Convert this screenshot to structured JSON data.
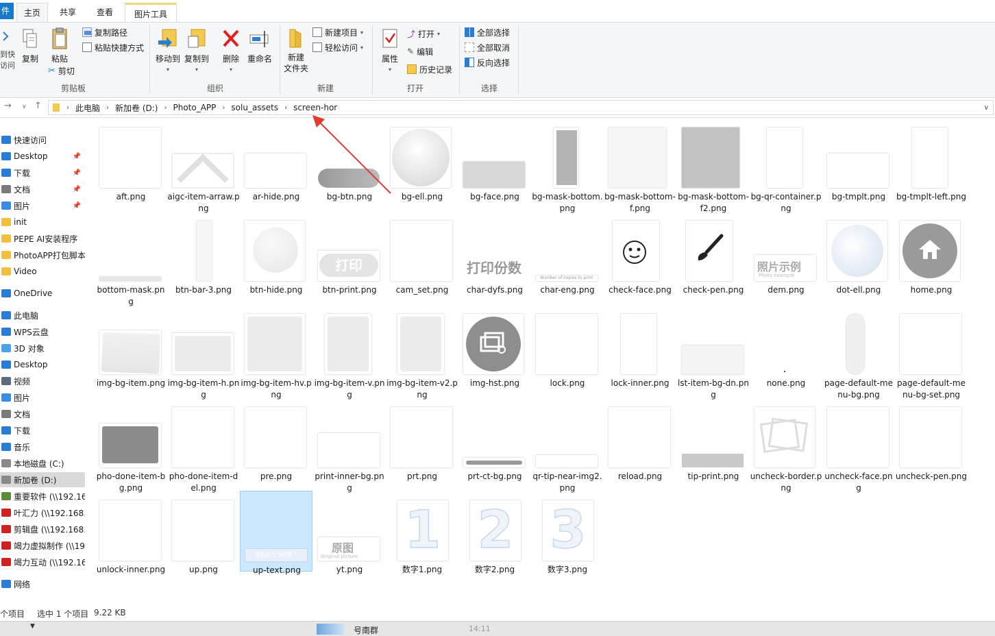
{
  "tabs": {
    "file": "件",
    "home": "主页",
    "share": "共享",
    "view": "查看",
    "picture_tools": "图片工具"
  },
  "ribbon": {
    "pin_quick": [
      "到快",
      "访问"
    ],
    "copy": "复制",
    "paste": "粘贴",
    "copy_path": "复制路径",
    "paste_shortcut": "粘贴快捷方式",
    "cut": "剪切",
    "clipboard_group": "剪贴板",
    "move_to": "移动到",
    "copy_to": "复制到",
    "delete": "删除",
    "rename": "重命名",
    "organize_group": "组织",
    "new_folder": [
      "新建",
      "文件夹"
    ],
    "new_item": "新建项目",
    "easy_access": "轻松访问",
    "new_group": "新建",
    "properties": "属性",
    "open": "打开",
    "edit": "编辑",
    "history": "历史记录",
    "open_group": "打开",
    "select_all": "全部选择",
    "select_none": "全部取消",
    "invert_selection": "反向选择",
    "select_group": "选择"
  },
  "address": {
    "crumbs": [
      "此电脑",
      "新加卷 (D:)",
      "Photo_APP",
      "solu_assets",
      "screen-hor"
    ]
  },
  "nav": {
    "items": [
      {
        "label": "快速访问",
        "icon": "star-icon",
        "color": "#2b7cd3",
        "pinned": false
      },
      {
        "label": "Desktop",
        "icon": "desktop-icon",
        "color": "#2b7cd3",
        "pinned": true
      },
      {
        "label": "下载",
        "icon": "download-icon",
        "color": "#2b7cd3",
        "pinned": true
      },
      {
        "label": "文档",
        "icon": "document-icon",
        "color": "#7a7a7a",
        "pinned": true
      },
      {
        "label": "图片",
        "icon": "picture-icon",
        "color": "#3a8dde",
        "pinned": true
      },
      {
        "label": "init",
        "icon": "folder-icon",
        "color": "#f0c040",
        "pinned": false
      },
      {
        "label": "PEPE AI安装程序",
        "icon": "folder-icon",
        "color": "#f0c040",
        "pinned": false
      },
      {
        "label": "PhotoAPP打包脚本",
        "icon": "folder-icon",
        "color": "#f0c040",
        "pinned": false
      },
      {
        "label": "Video",
        "icon": "folder-icon",
        "color": "#f0c040",
        "pinned": false
      },
      {
        "label": "OneDrive",
        "icon": "cloud-icon",
        "color": "#2b7cd3",
        "pinned": false
      },
      {
        "label": "此电脑",
        "icon": "computer-icon",
        "color": "#2b7cd3",
        "pinned": false
      },
      {
        "label": "WPS云盘",
        "icon": "cloud-icon",
        "color": "#2b7cd3",
        "pinned": false
      },
      {
        "label": "3D 对象",
        "icon": "cube-icon",
        "color": "#4aa3e8",
        "pinned": false
      },
      {
        "label": "Desktop",
        "icon": "desktop-icon",
        "color": "#2b7cd3",
        "pinned": false
      },
      {
        "label": "视频",
        "icon": "video-icon",
        "color": "#5a6a7a",
        "pinned": false
      },
      {
        "label": "图片",
        "icon": "picture-icon",
        "color": "#3a8dde",
        "pinned": false
      },
      {
        "label": "文档",
        "icon": "document-icon",
        "color": "#7a7a7a",
        "pinned": false
      },
      {
        "label": "下载",
        "icon": "download-icon",
        "color": "#2b7cd3",
        "pinned": false
      },
      {
        "label": "音乐",
        "icon": "music-icon",
        "color": "#2b7cd3",
        "pinned": false
      },
      {
        "label": "本地磁盘 (C:)",
        "icon": "drive-icon",
        "color": "#8a8a8a",
        "pinned": false
      },
      {
        "label": "新加卷 (D:)",
        "icon": "drive-icon",
        "color": "#8a8a8a",
        "pinned": false,
        "selected": true
      },
      {
        "label": "重要软件 (\\\\192.16",
        "icon": "network-drive-icon",
        "color": "#5a8a3a",
        "pinned": false
      },
      {
        "label": "叶汇力 (\\\\192.168.",
        "icon": "disconnected-drive-icon",
        "color": "#cc2222",
        "pinned": false
      },
      {
        "label": "剪辑盘 (\\\\192.168.",
        "icon": "disconnected-drive-icon",
        "color": "#cc2222",
        "pinned": false
      },
      {
        "label": "竭力虚拟制作 (\\\\19",
        "icon": "disconnected-drive-icon",
        "color": "#cc2222",
        "pinned": false
      },
      {
        "label": "竭力互动 (\\\\192.16",
        "icon": "disconnected-drive-icon",
        "color": "#cc2222",
        "pinned": false
      },
      {
        "label": "网络",
        "icon": "network-icon",
        "color": "#2b7cd3",
        "pinned": false
      }
    ]
  },
  "files": [
    {
      "name": "aft.png",
      "kind": "blank"
    },
    {
      "name": "aigc-item-arraw.png",
      "kind": "chevron"
    },
    {
      "name": "ar-hide.png",
      "kind": "blank-short"
    },
    {
      "name": "bg-btn.png",
      "kind": "pill-gray"
    },
    {
      "name": "bg-ell.png",
      "kind": "sphere"
    },
    {
      "name": "bg-face.png",
      "kind": "bar-light"
    },
    {
      "name": "bg-mask-bottom.png",
      "kind": "tall-gray"
    },
    {
      "name": "bg-mask-bottom-f.png",
      "kind": "blank-soft"
    },
    {
      "name": "bg-mask-bottom-f2.png",
      "kind": "square-gray"
    },
    {
      "name": "bg-qr-container.png",
      "kind": "tall-blank"
    },
    {
      "name": "bg-tmplt.png",
      "kind": "blank-short"
    },
    {
      "name": "bg-tmplt-left.png",
      "kind": "tall-blank"
    },
    {
      "name": "bottom-mask.png",
      "kind": "line-bottom"
    },
    {
      "name": "btn-bar-3.png",
      "kind": "narrow"
    },
    {
      "name": "btn-hide.png",
      "kind": "circle-soft"
    },
    {
      "name": "btn-print.png",
      "kind": "print-btn",
      "text": "打印"
    },
    {
      "name": "cam_set.png",
      "kind": "blank"
    },
    {
      "name": "char-dyfs.png",
      "kind": "text-big",
      "text": "打印份数"
    },
    {
      "name": "char-eng.png",
      "kind": "text-small",
      "text": "Number of copies to print"
    },
    {
      "name": "check-face.png",
      "kind": "face"
    },
    {
      "name": "check-pen.png",
      "kind": "pen"
    },
    {
      "name": "dem.png",
      "kind": "photo-example",
      "text": "照片示例",
      "sub": "Photo example"
    },
    {
      "name": "dot-ell.png",
      "kind": "dot-ell"
    },
    {
      "name": "home.png",
      "kind": "home"
    },
    {
      "name": "img-bg-item.png",
      "kind": "soft-square"
    },
    {
      "name": "img-bg-item-h.png",
      "kind": "soft-wide"
    },
    {
      "name": "img-bg-item-hv.png",
      "kind": "soft-square2"
    },
    {
      "name": "img-bg-item-v.png",
      "kind": "soft-tall"
    },
    {
      "name": "img-bg-item-v2.png",
      "kind": "soft-tall"
    },
    {
      "name": "img-hst.png",
      "kind": "img-hst"
    },
    {
      "name": "lock.png",
      "kind": "blank"
    },
    {
      "name": "lock-inner.png",
      "kind": "tall-blank"
    },
    {
      "name": "lst-item-bg-dn.png",
      "kind": "soft-bar"
    },
    {
      "name": "none.png",
      "kind": "none"
    },
    {
      "name": "page-default-menu-bg.png",
      "kind": "capsule"
    },
    {
      "name": "page-default-menu-bg-set.png",
      "kind": "blank"
    },
    {
      "name": "pho-done-item-bg.png",
      "kind": "dark-square"
    },
    {
      "name": "pho-done-item-del.png",
      "kind": "blank"
    },
    {
      "name": "pre.png",
      "kind": "blank"
    },
    {
      "name": "print-inner-bg.png",
      "kind": "blank-short"
    },
    {
      "name": "prt.png",
      "kind": "blank"
    },
    {
      "name": "prt-ct-bg.png",
      "kind": "slider"
    },
    {
      "name": "qr-tip-near-img2.png",
      "kind": "thin-line"
    },
    {
      "name": "reload.png",
      "kind": "blank"
    },
    {
      "name": "tip-print.png",
      "kind": "gray-bar"
    },
    {
      "name": "uncheck-border.png",
      "kind": "uncheck-border"
    },
    {
      "name": "uncheck-face.png",
      "kind": "blank"
    },
    {
      "name": "uncheck-pen.png",
      "kind": "blank"
    },
    {
      "name": "unlock-inner.png",
      "kind": "blank"
    },
    {
      "name": "up.png",
      "kind": "blank"
    },
    {
      "name": "up-text.png",
      "kind": "up-text",
      "text": "请拖动上方边框↑",
      "selected": true
    },
    {
      "name": "yt.png",
      "kind": "original",
      "text": "原图",
      "sub": "Original picture"
    },
    {
      "name": "数字1.png",
      "kind": "digit",
      "text": "1"
    },
    {
      "name": "数字2.png",
      "kind": "digit",
      "text": "2"
    },
    {
      "name": "数字3.png",
      "kind": "digit",
      "text": "3"
    }
  ],
  "status": {
    "count": "个项目",
    "selection": "选中 1 个项目",
    "size": "9.22 KB"
  },
  "taskbar": {
    "app_label": "号南群",
    "time": "14:11"
  }
}
